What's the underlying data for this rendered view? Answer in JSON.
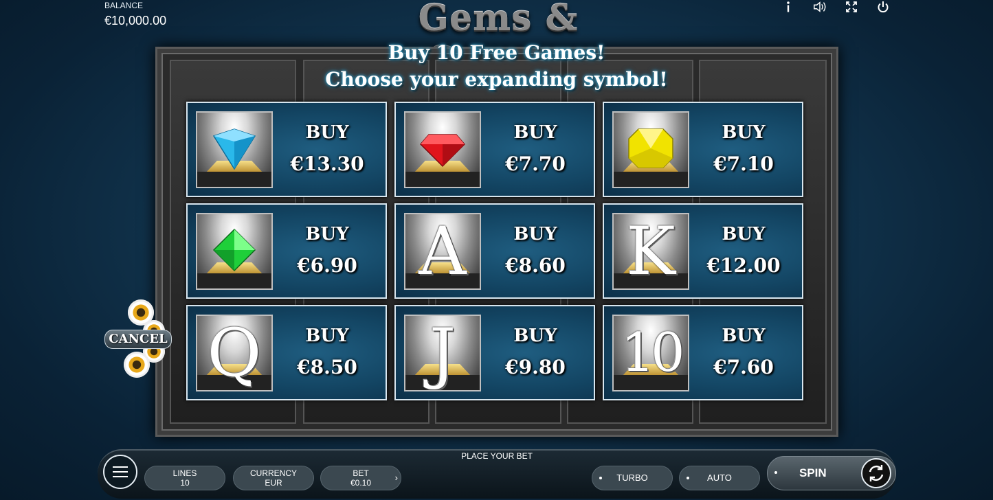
{
  "header": {
    "balance_label": "BALANCE",
    "balance_value": "€10,000.00",
    "logo": "Gems & Stones",
    "icons": [
      "info-icon",
      "sound-icon",
      "fullscreen-icon",
      "power-icon"
    ]
  },
  "offer": {
    "title": "Buy 10 Free Games!",
    "subtitle": "Choose your expanding symbol!",
    "buy_label": "BUY",
    "cards": [
      {
        "symbol": "blue-diamond",
        "price": "€13.30",
        "color": "#2ab8ea"
      },
      {
        "symbol": "red-ruby",
        "price": "€7.70",
        "color": "#e0141c"
      },
      {
        "symbol": "yellow-topaz",
        "price": "€7.10",
        "color": "#f1e300"
      },
      {
        "symbol": "green-emerald",
        "price": "€6.90",
        "color": "#1fcf3a"
      },
      {
        "symbol": "A",
        "price": "€8.60"
      },
      {
        "symbol": "K",
        "price": "€12.00"
      },
      {
        "symbol": "Q",
        "price": "€8.50"
      },
      {
        "symbol": "J",
        "price": "€9.80"
      },
      {
        "symbol": "10",
        "price": "€7.60"
      }
    ]
  },
  "cancel_label": "CANCEL",
  "footer": {
    "place_bet": "PLACE YOUR BET",
    "lines_label": "LINES",
    "lines_value": "10",
    "currency_label": "CURRENCY",
    "currency_value": "EUR",
    "bet_label": "BET",
    "bet_value": "€0.10",
    "turbo_label": "TURBO",
    "auto_label": "AUTO",
    "spin_label": "SPIN"
  }
}
